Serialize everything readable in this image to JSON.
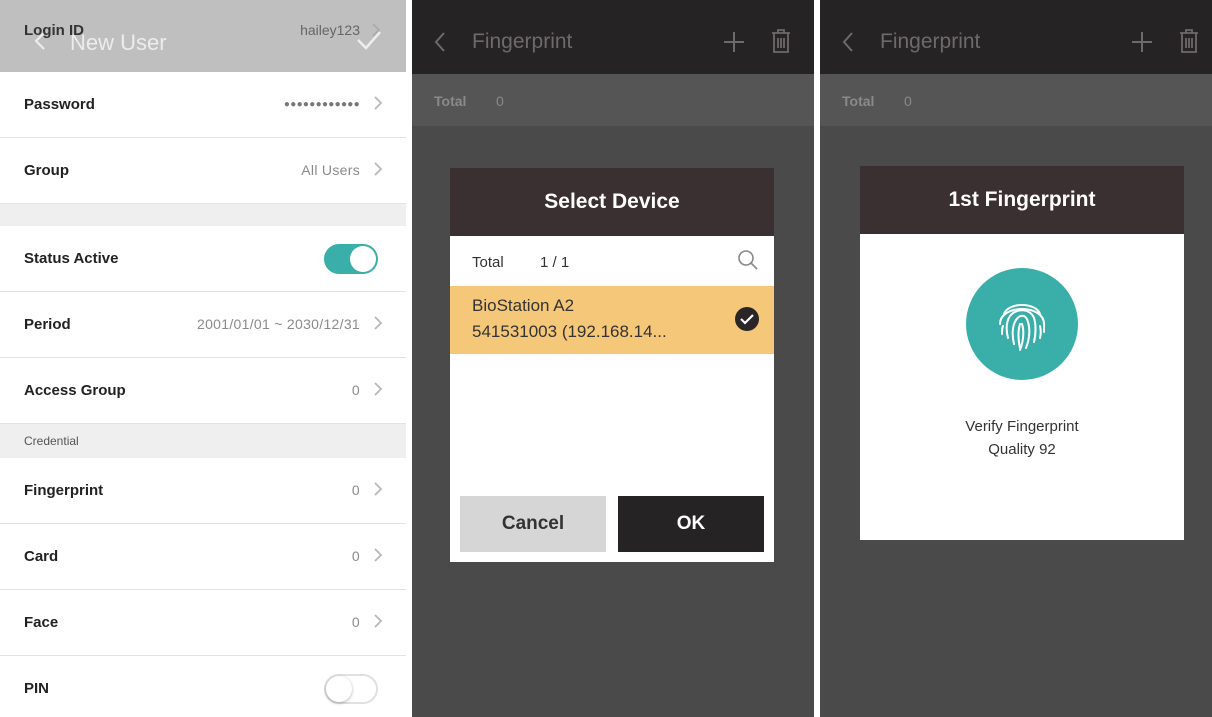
{
  "new_user": {
    "title": "New User",
    "login_id": {
      "label": "Login ID",
      "value": "hailey123"
    },
    "rows": [
      {
        "label": "Password",
        "value": "●●●●●●●●●●●●"
      },
      {
        "label": "Group",
        "value": "All Users"
      }
    ],
    "status_active": {
      "label": "Status Active",
      "on": true
    },
    "period": {
      "label": "Period",
      "value": "2001/01/01 ~ 2030/12/31"
    },
    "access_group": {
      "label": "Access Group",
      "value": "0"
    },
    "credential_section": "Credential",
    "credentials": [
      {
        "label": "Fingerprint",
        "value": "0"
      },
      {
        "label": "Card",
        "value": "0"
      },
      {
        "label": "Face",
        "value": "0"
      }
    ],
    "pin": {
      "label": "PIN",
      "on": false
    }
  },
  "select_device_screen": {
    "title": "Fingerprint",
    "total_label": "Total",
    "total_value": "0",
    "dialog": {
      "title": "Select Device",
      "total_label": "Total",
      "total_value": "1 / 1",
      "device_line1": "BioStation A2",
      "device_line2": "541531003 (192.168.14...",
      "cancel_label": "Cancel",
      "ok_label": "OK"
    }
  },
  "fingerprint_screen": {
    "title": "Fingerprint",
    "total_label": "Total",
    "total_value": "0",
    "dialog": {
      "title": "1st Fingerprint",
      "line1": "Verify Fingerprint",
      "line2": "Quality 92"
    }
  },
  "colors": {
    "accent_teal": "#3aafa9",
    "dark_header": "#262324",
    "dialog_header": "#3a2f31",
    "selected_row": "#f5c779"
  }
}
